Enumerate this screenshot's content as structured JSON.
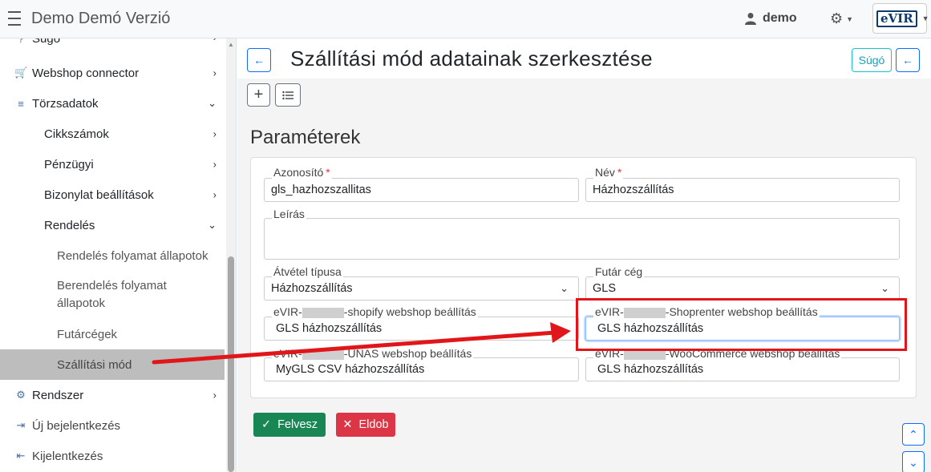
{
  "app": {
    "title": "Demo Demó Verzió"
  },
  "topbar": {
    "user_name": "demo",
    "logo_text": "eVIR"
  },
  "sidebar": {
    "items": [
      {
        "label": "Súgó",
        "icon": "help-icon",
        "glyph": "?",
        "chev": "›"
      },
      {
        "label": "Webshop connector",
        "icon": "cart-icon",
        "glyph": "🛒",
        "chev": "›"
      },
      {
        "label": "Törzsadatok",
        "icon": "database-icon",
        "glyph": "≡",
        "chev": "⌄"
      },
      {
        "label": "Cikkszámok",
        "chev": "›"
      },
      {
        "label": "Pénzügyi",
        "chev": "›"
      },
      {
        "label": "Bizonylat beállítások",
        "chev": "›"
      },
      {
        "label": "Rendelés",
        "chev": "⌄"
      },
      {
        "label": "Rendelés folyamat állapotok"
      },
      {
        "label": "Berendelés folyamat állapotok"
      },
      {
        "label": "Futárcégek"
      },
      {
        "label": "Szállítási mód"
      },
      {
        "label": "Rendszer",
        "icon": "cogs-icon",
        "glyph": "⚙",
        "chev": "›"
      },
      {
        "label": "Új bejelentkezés",
        "icon": "sign-in-icon",
        "glyph": "⇥"
      },
      {
        "label": "Kijelentkezés",
        "icon": "sign-out-icon",
        "glyph": "⇤"
      }
    ]
  },
  "page": {
    "title": "Szállítási mód adatainak szerkesztése",
    "help_button": "Súgó",
    "section_title": "Paraméterek"
  },
  "form": {
    "id_label": "Azonosító",
    "id_value": "gls_hazhozszallitas",
    "name_label": "Név",
    "name_value": "Házhozszállítás",
    "desc_label": "Leírás",
    "receipt_type_label": "Átvétel típusa",
    "receipt_type_value": "Házhozszállítás",
    "courier_label": "Futár cég",
    "courier_value": "GLS",
    "shopify_label_prefix": "eVIR-",
    "shopify_label_suffix": "-shopify webshop beállítás",
    "shopify_value": "GLS házhozszállítás",
    "shoprenter_label_prefix": "eVIR-",
    "shoprenter_label_suffix": "-Shoprenter webshop beállítás",
    "shoprenter_value": "GLS házhozszállítás",
    "unas_label_prefix": "eVIR-",
    "unas_label_suffix": "-UNAS webshop beállítás",
    "unas_value": "MyGLS CSV házhozszállítás",
    "woo_label_prefix": "eVIR-",
    "woo_label_suffix": "-WooCommerce webshop beállítás",
    "woo_value": "GLS házhozszállítás",
    "required_mark": "*"
  },
  "actions": {
    "save": "Felvesz",
    "discard": "Eldob"
  },
  "colors": {
    "primary": "#0d6efd",
    "success": "#198754",
    "danger": "#dc3545",
    "annotation": "#e0161b"
  }
}
